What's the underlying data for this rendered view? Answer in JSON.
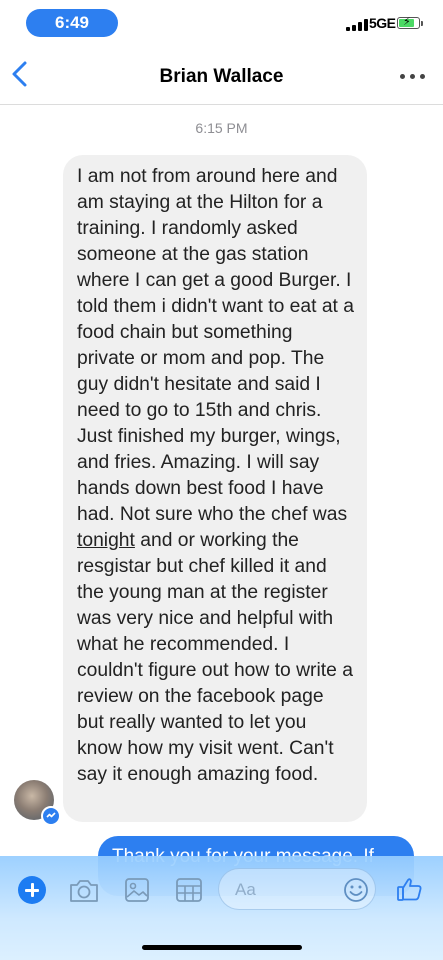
{
  "status_bar": {
    "time": "6:49",
    "network": "5GE"
  },
  "header": {
    "title": "Brian Wallace"
  },
  "chat": {
    "timestamp": "6:15 PM",
    "incoming": {
      "text_before": "I am not from around here and am staying at the Hilton for a training. I randomly asked someone at the gas station where I can get a good Burger. I told them i didn't want to eat at a food chain but something private or mom and pop. The guy didn't hesitate and said I need to go to 15th and chris. Just finished my burger, wings, and fries. Amazing. I will say hands down best food I have had. Not sure who the chef was ",
      "underlined": "tonight",
      "text_after": " and or working the resgistar but chef killed it and the young man at the register was very nice and helpful with what he recommended. I couldn't figure out how to write a review on the facebook page but really wanted to let you know how my visit went. Can't say it enough amazing food."
    },
    "outgoing": {
      "text": "Thank you for your message.  If"
    }
  },
  "composer": {
    "placeholder": "Aa",
    "icons": [
      "plus-icon",
      "camera-icon",
      "photo-icon",
      "gif-icon",
      "emoji-icon",
      "thumbs-up-icon"
    ]
  },
  "colors": {
    "accent": "#2d7ff0",
    "bubble_incoming": "#f0f0f0"
  }
}
